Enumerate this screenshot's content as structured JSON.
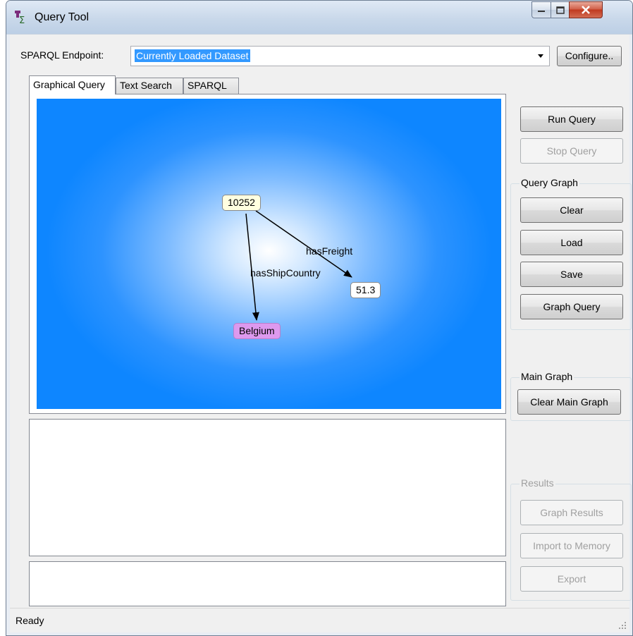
{
  "window": {
    "title": "Query Tool"
  },
  "endpoint": {
    "label": "SPARQL Endpoint:",
    "value": "Currently Loaded Dataset",
    "configure_label": "Configure.."
  },
  "tabs": [
    {
      "label": "Graphical Query",
      "active": true
    },
    {
      "label": "Text Search",
      "active": false
    },
    {
      "label": "SPARQL",
      "active": false
    }
  ],
  "graph": {
    "nodes": [
      {
        "label": "10252",
        "fill": "#ffffe0"
      },
      {
        "label": "51.3",
        "fill": "#ffffff"
      },
      {
        "label": "Belgium",
        "fill": "#dd99ee"
      }
    ],
    "edges": [
      {
        "label": "hasFreight",
        "from": "10252",
        "to": "51.3"
      },
      {
        "label": "hasShipCountry",
        "from": "10252",
        "to": "Belgium"
      }
    ],
    "background_colors": {
      "center": "#ffffff",
      "edge": "#0e86ff"
    }
  },
  "buttons": {
    "run_query": "Run Query",
    "stop_query": "Stop Query"
  },
  "query_graph": {
    "title": "Query Graph",
    "clear": "Clear",
    "load": "Load",
    "save": "Save",
    "graph_query": "Graph Query"
  },
  "main_graph": {
    "title": "Main Graph",
    "clear_main_graph": "Clear Main Graph"
  },
  "results": {
    "title": "Results",
    "graph_results": "Graph Results",
    "import_to_memory": "Import to Memory",
    "export": "Export"
  },
  "status": {
    "text": "Ready"
  }
}
